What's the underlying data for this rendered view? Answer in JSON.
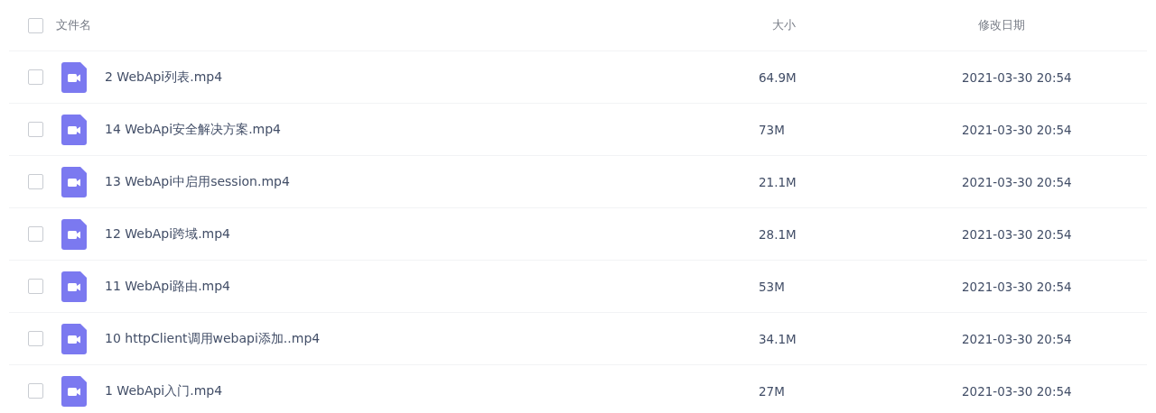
{
  "header": {
    "checked": false,
    "columns": [
      "文件名",
      "大小",
      "修改日期"
    ]
  },
  "files": [
    {
      "name": "2 WebApi列表.mp4",
      "size": "64.9M",
      "modified": "2021-03-30 20:54",
      "checked": false
    },
    {
      "name": "14 WebApi安全解决方案.mp4",
      "size": "73M",
      "modified": "2021-03-30 20:54",
      "checked": false
    },
    {
      "name": "13 WebApi中启用session.mp4",
      "size": "21.1M",
      "modified": "2021-03-30 20:54",
      "checked": false
    },
    {
      "name": "12 WebApi跨域.mp4",
      "size": "28.1M",
      "modified": "2021-03-30 20:54",
      "checked": false
    },
    {
      "name": "11 WebApi路由.mp4",
      "size": "53M",
      "modified": "2021-03-30 20:54",
      "checked": false
    },
    {
      "name": "10 httpClient调用webapi添加..mp4",
      "size": "34.1M",
      "modified": "2021-03-30 20:54",
      "checked": false
    },
    {
      "name": "1 WebApi入门.mp4",
      "size": "27M",
      "modified": "2021-03-30 20:54",
      "checked": false
    }
  ]
}
